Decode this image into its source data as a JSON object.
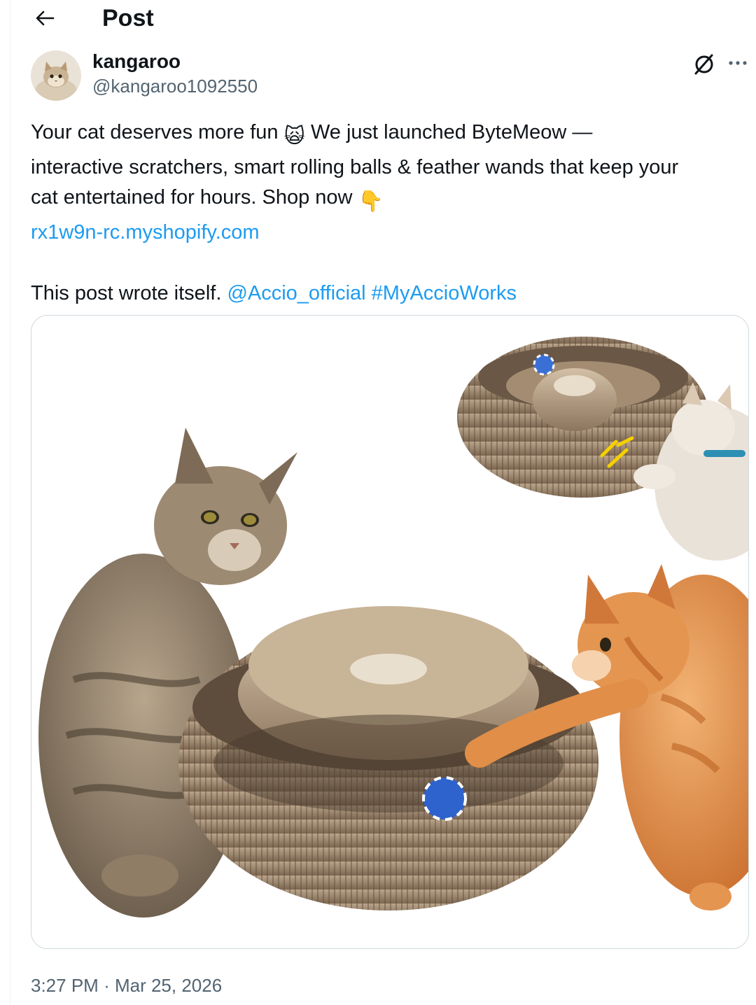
{
  "header": {
    "title": "Post",
    "back_icon": "arrow-left-icon"
  },
  "author": {
    "display_name": "kangaroo",
    "handle": "@kangaroo1092550",
    "avatar": "cat-avatar"
  },
  "actions": {
    "grok_icon": "grok-icon",
    "more_icon": "more-horizontal-icon"
  },
  "post": {
    "line1_a": "Your cat deserves more fun",
    "line1_emoji": "🙀",
    "line1_b": "We just launched ByteMeow —",
    "line2": "interactive scratchers, smart rolling balls & feather wands that keep your",
    "line3": "cat entertained for hours. Shop now",
    "line3_emoji": "👇",
    "url": "rx1w9n-rc.myshopify.com",
    "line5_text": "This post wrote itself.",
    "mention": "@Accio_official",
    "hashtag": "#MyAccioWorks"
  },
  "media": {
    "description_icon": "product-photo-cats-with-cardboard-scratchers"
  },
  "meta": {
    "time": "3:27 PM",
    "separator": "·",
    "date": "Mar 25, 2026"
  }
}
